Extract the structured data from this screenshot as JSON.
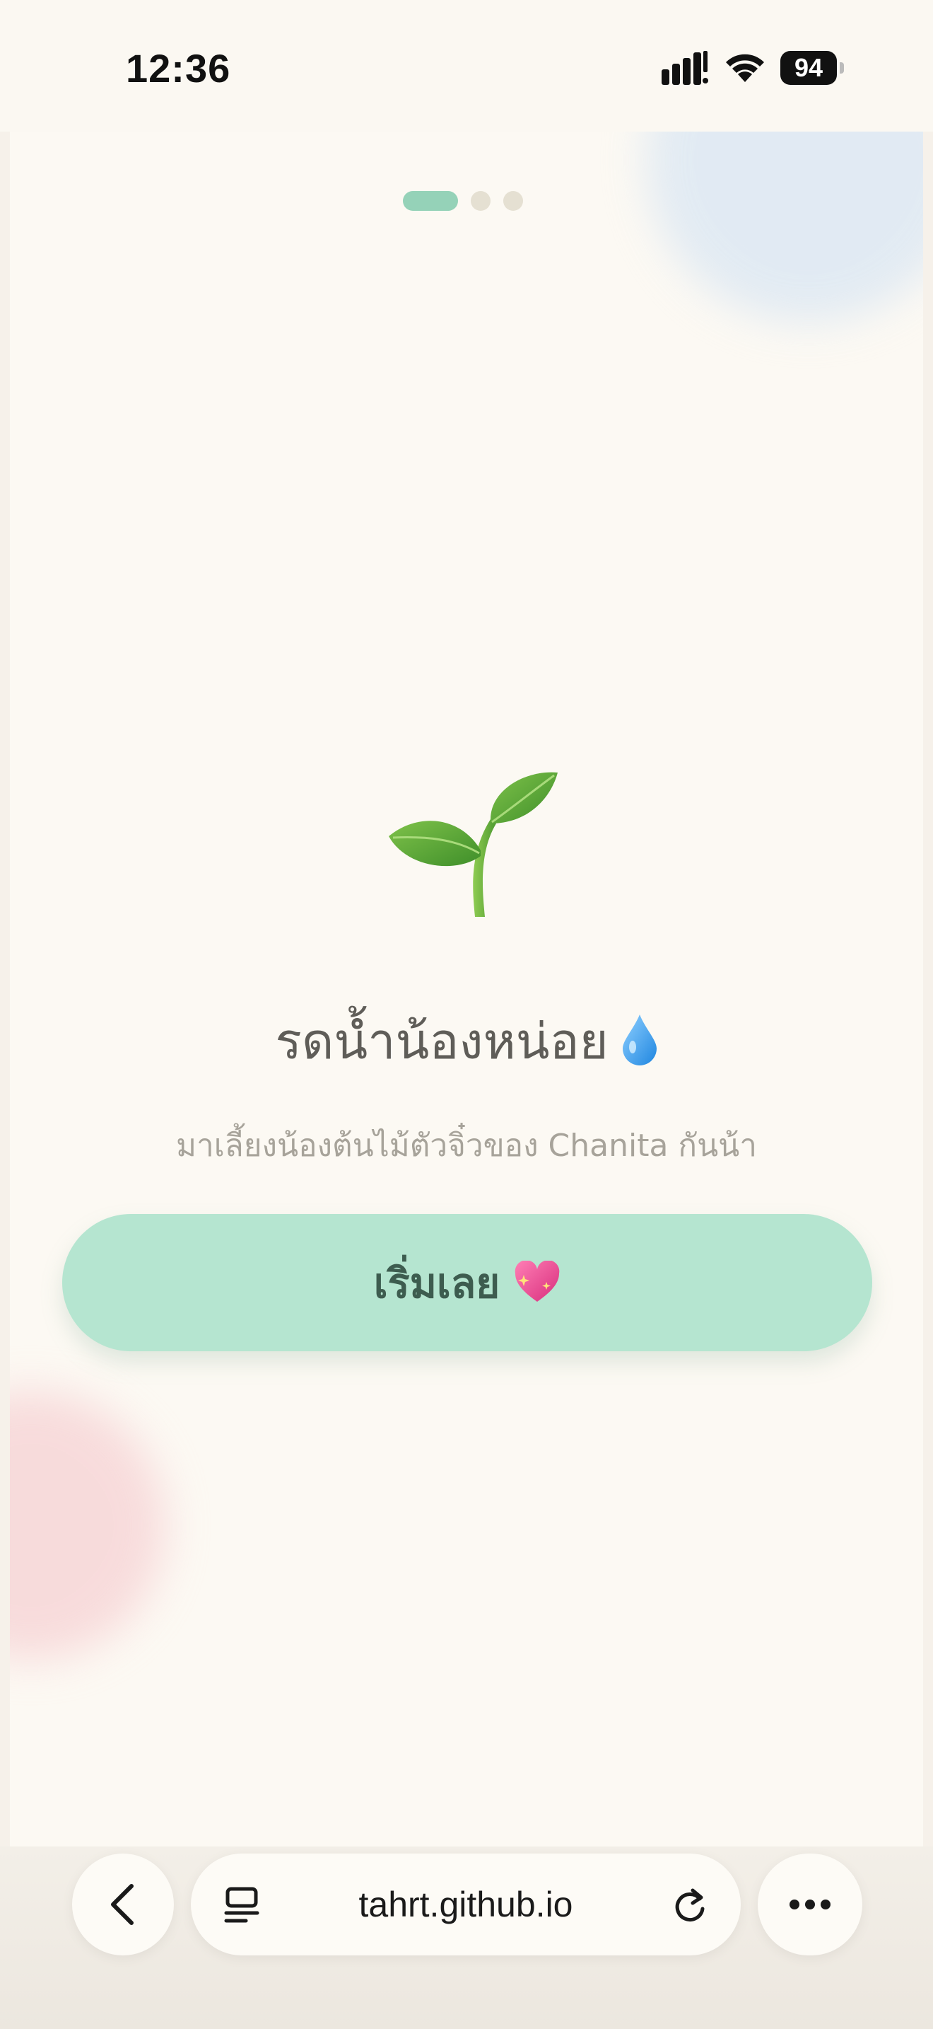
{
  "status_bar": {
    "time": "12:36",
    "battery": "94",
    "icons": [
      "signal-icon",
      "wifi-icon",
      "battery-icon"
    ]
  },
  "onboarding": {
    "pager": {
      "total": 3,
      "current": 1
    },
    "hero_icon": "sprout-icon",
    "title": "รดน้ำน้องหน่อย",
    "title_icon": "water-drop-icon",
    "subtitle": "มาเลี้ยงน้องต้นไม้ตัวจิ๋วของ Chanita กันน้า",
    "start_button_label": "เริ่มเลย",
    "start_button_icon": "sparkling-heart-icon",
    "colors": {
      "accent": "#b5e5d0",
      "accent_text": "#3d5c4f",
      "pager_active": "#95d2b8",
      "background": "#fcf9f3"
    }
  },
  "browser": {
    "url": "tahrt.github.io",
    "icons": [
      "back-icon",
      "tabs-icon",
      "reload-icon",
      "more-icon"
    ]
  }
}
